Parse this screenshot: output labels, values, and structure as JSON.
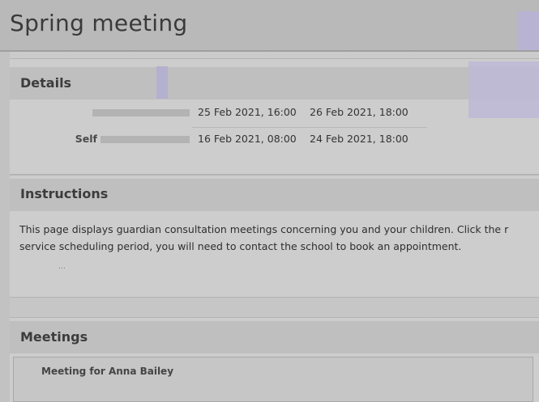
{
  "page": {
    "title": "Spring meeting"
  },
  "details": {
    "heading": "Details",
    "rows": [
      {
        "label": "",
        "start": "25 Feb 2021, 16:00",
        "end": "26 Feb 2021, 18:00"
      },
      {
        "label": "Self",
        "start": "16 Feb 2021, 08:00",
        "end": "24 Feb 2021, 18:00"
      }
    ]
  },
  "instructions": {
    "heading": "Instructions",
    "line1": "This page displays guardian consultation meetings concerning you and your children. Click the r",
    "line2": "service scheduling period, you will need to contact the school to book an appointment.",
    "small": "…"
  },
  "meetings": {
    "heading": "Meetings",
    "items": [
      {
        "label": "Meeting for Anna Bailey"
      }
    ]
  },
  "colors": {
    "accent": "#b8b3d2",
    "background": "#c9c9c9"
  }
}
